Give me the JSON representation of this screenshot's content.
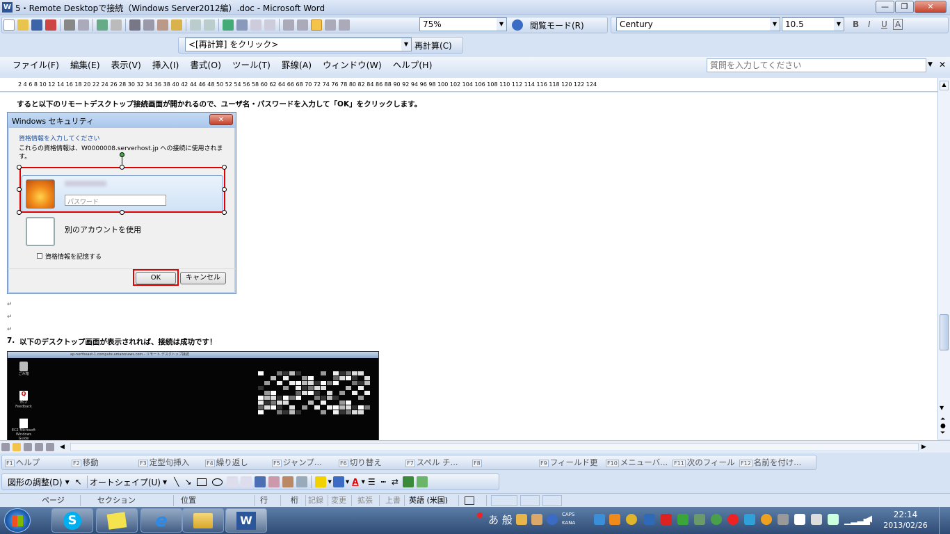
{
  "window": {
    "title": "5・Remote Desktopで接続（Windows Server2012編）.doc - Microsoft Word",
    "minimize": "—",
    "restore": "❐",
    "close": "✕"
  },
  "toolbar1": {
    "zoom": "75%",
    "reading_mode": "閲覧モード(R)",
    "font": "Century",
    "font_size": "10.5",
    "bold": "B",
    "italic": "I",
    "underline": "U",
    "char_border": "A"
  },
  "toolbar2": {
    "field_combo": "<[再計算] をクリック>",
    "recalc_button": "再計算(C)"
  },
  "menu": {
    "items": [
      "ファイル(F)",
      "編集(E)",
      "表示(V)",
      "挿入(I)",
      "書式(O)",
      "ツール(T)",
      "罫線(A)",
      "ウィンドウ(W)",
      "ヘルプ(H)"
    ],
    "help_placeholder": "質問を入力してください"
  },
  "ruler": {
    "ticks": "2   4   6   8   10   12   14   16   18   20   22   24   26   28   30   32   34   36   38   40   42   44   46   48   50   52   54   56   58   60   62   64   66   68   70   72   74   76   78   80   82   84   86   88   90   92   94   96   98   100   102   104   106   108   110   112   114   116   118   120   122   124"
  },
  "document": {
    "para1": "すると以下のリモートデスクトップ接続画面が開かれるので、ユーザ名・パスワードを入力して「OK」をクリックします。",
    "para7_number": "7.",
    "para7": "以下のデスクトップ画面が表示されれば、接続は成功です！",
    "dialog": {
      "title": "Windows セキュリティ",
      "heading": "資格情報を入力してください",
      "description": "これらの資格情報は、W0000008.serverhost.jp への接続に使用されます。",
      "password_placeholder": "パスワード",
      "other_account": "別のアカウントを使用",
      "remember": "資格情報を記憶する",
      "ok": "OK",
      "cancel": "キャンセル"
    },
    "desktop": {
      "titlebar": "ap-northeast-1.compute.amazonaws.com - リモート デスクトップ接続",
      "icons": [
        "ごみ箱",
        "EC2 Feedback",
        "EC2 Microsoft Windows Guide"
      ]
    }
  },
  "function_keys": [
    {
      "key": "F1",
      "label": "ヘルプ"
    },
    {
      "key": "F2",
      "label": "移動"
    },
    {
      "key": "F3",
      "label": "定型句挿入"
    },
    {
      "key": "F4",
      "label": "繰り返し"
    },
    {
      "key": "F5",
      "label": "ジャンプ..."
    },
    {
      "key": "F6",
      "label": "切り替え"
    },
    {
      "key": "F7",
      "label": "スペル チ..."
    },
    {
      "key": "F8",
      "label": ""
    },
    {
      "key": "F9",
      "label": "フィールド更"
    },
    {
      "key": "F10",
      "label": "メニューバ..."
    },
    {
      "key": "F11",
      "label": "次のフィール"
    },
    {
      "key": "F12",
      "label": "名前を付け..."
    }
  ],
  "drawing_toolbar": {
    "adjust": "図形の調整(D)",
    "autoshape": "オートシェイプ(U)"
  },
  "status": {
    "page": "ページ",
    "section": "セクション",
    "position": "位置",
    "line": "行",
    "column": "桁",
    "rec": "記録",
    "trk": "変更",
    "ext": "拡張",
    "ovr": "上書",
    "language": "英語 (米国)"
  },
  "taskbar": {
    "ime": "あ 般",
    "caps": "CAPS",
    "kana": "KANA",
    "time": "22:14",
    "date": "2013/02/26"
  },
  "colors": {
    "accent": "#2b579a",
    "highlight_box": "#e00000"
  }
}
